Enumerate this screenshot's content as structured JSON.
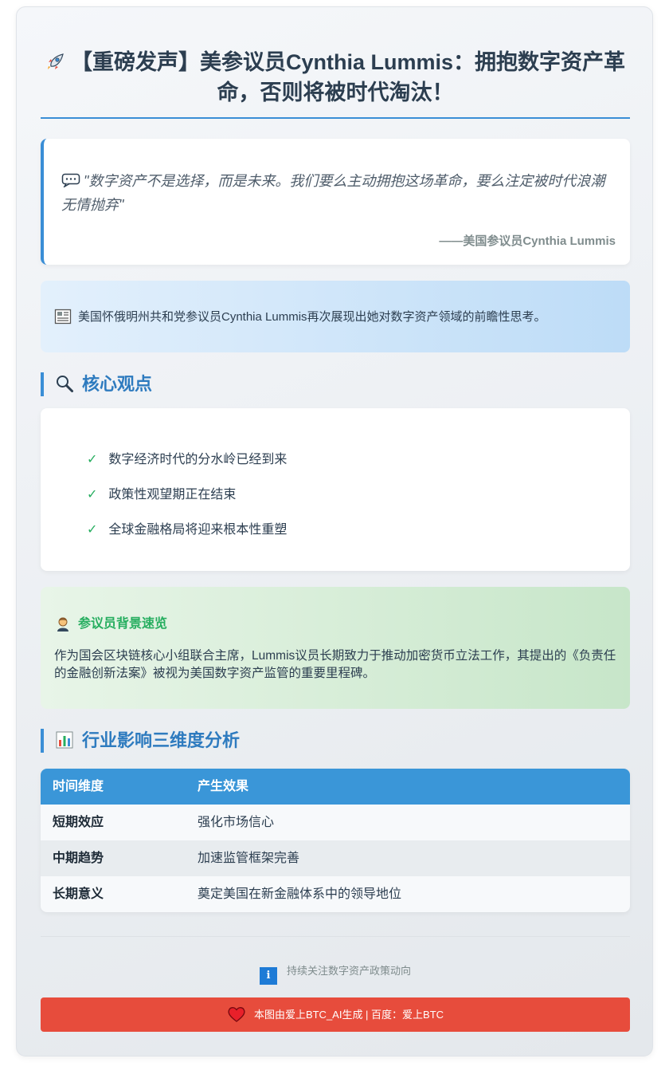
{
  "header": {
    "title": "【重磅发声】美参议员Cynthia Lummis：拥抱数字资产革命，否则将被时代淘汰！",
    "icon": "rocket-icon"
  },
  "quote": {
    "text": "\"数字资产不是选择，而是未来。我们要么主动拥抱这场革命，要么注定被时代浪潮无情抛弃\"",
    "author": "——美国参议员Cynthia Lummis",
    "icon": "speech-bubble-icon"
  },
  "intro": {
    "text": "美国怀俄明州共和党参议员Cynthia Lummis再次展现出她对数字资产领域的前瞻性思考。",
    "icon": "newspaper-icon"
  },
  "core_views": {
    "heading": "核心观点",
    "icon": "magnifier-icon",
    "items": [
      {
        "mark": "✓",
        "text": "数字经济时代的分水岭已经到来"
      },
      {
        "mark": "✓",
        "text": "政策性观望期正在结束"
      },
      {
        "mark": "✓",
        "text": "全球金融格局将迎来根本性重塑"
      }
    ]
  },
  "background": {
    "title": "参议员背景速览",
    "icon": "person-icon",
    "text": "作为国会区块链核心小组联合主席，Lummis议员长期致力于推动加密货币立法工作，其提出的《负责任的金融创新法案》被视为美国数字资产监管的重要里程碑。"
  },
  "impact": {
    "heading": "行业影响三维度分析",
    "icon": "bar-chart-icon",
    "columns": [
      "时间维度",
      "产生效果"
    ],
    "rows": [
      {
        "dimension": "短期效应",
        "effect": "强化市场信心"
      },
      {
        "dimension": "中期趋势",
        "effect": "加速监管框架完善"
      },
      {
        "dimension": "长期意义",
        "effect": "奠定美国在新金融体系中的领导地位"
      }
    ]
  },
  "follow": {
    "icon_glyph": "i",
    "text": "持续关注数字资产政策动向"
  },
  "footer": {
    "text": "本图由爱上BTC_AI生成 | 百度：爱上BTC",
    "icon": "heart-icon"
  },
  "colors": {
    "accent": "#3a8ed6",
    "table_header": "#3a96d8",
    "check": "#27ae60",
    "footer": "#e74c3c"
  }
}
